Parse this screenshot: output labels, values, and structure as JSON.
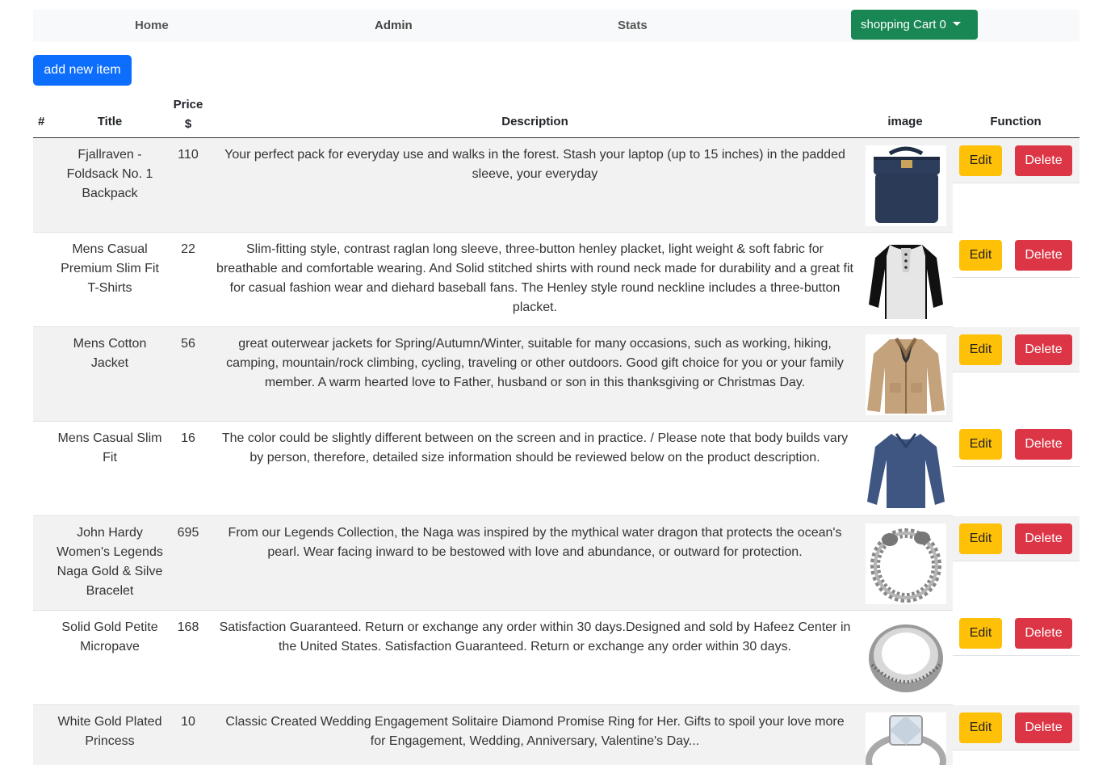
{
  "nav": {
    "home": "Home",
    "admin": "Admin",
    "stats": "Stats",
    "cart": "shopping Cart 0"
  },
  "add_button": "add new item",
  "table": {
    "headers": {
      "num": "#",
      "title": "Title",
      "price_line1": "Price",
      "price_line2": "$",
      "description": "Description",
      "image": "image",
      "function": "Function"
    },
    "edit_label": "Edit",
    "delete_label": "Delete",
    "rows": [
      {
        "title": "Fjallraven - Foldsack No. 1 Backpack",
        "price": "110",
        "description": "Your perfect pack for everyday use and walks in the forest. Stash your laptop (up to 15 inches) in the padded sleeve, your everyday",
        "image": "backpack-image"
      },
      {
        "title": "Mens Casual Premium Slim Fit T-Shirts",
        "price": "22",
        "description": "Slim-fitting style, contrast raglan long sleeve, three-button henley placket, light weight & soft fabric for breathable and comfortable wearing. And Solid stitched shirts with round neck made for durability and a great fit for casual fashion wear and diehard baseball fans. The Henley style round neckline includes a three-button placket.",
        "image": "tshirt-image"
      },
      {
        "title": "Mens Cotton Jacket",
        "price": "56",
        "description": "great outerwear jackets for Spring/Autumn/Winter, suitable for many occasions, such as working, hiking, camping, mountain/rock climbing, cycling, traveling or other outdoors. Good gift choice for you or your family member. A warm hearted love to Father, husband or son in this thanksgiving or Christmas Day.",
        "image": "jacket-image"
      },
      {
        "title": "Mens Casual Slim Fit",
        "price": "16",
        "description": "The color could be slightly different between on the screen and in practice. / Please note that body builds vary by person, therefore, detailed size information should be reviewed below on the product description.",
        "image": "longsleeve-image"
      },
      {
        "title": "John Hardy Women's Legends Naga Gold & Silve Bracelet",
        "price": "695",
        "description": "From our Legends Collection, the Naga was inspired by the mythical water dragon that protects the ocean's pearl. Wear facing inward to be bestowed with love and abundance, or outward for protection.",
        "image": "bracelet-image"
      },
      {
        "title": "Solid Gold Petite Micropave",
        "price": "168",
        "description": "Satisfaction Guaranteed. Return or exchange any order within 30 days.Designed and sold by Hafeez Center in the United States. Satisfaction Guaranteed. Return or exchange any order within 30 days.",
        "image": "ring-image"
      },
      {
        "title": "White Gold Plated Princess",
        "price": "10",
        "description": "Classic Created Wedding Engagement Solitaire Diamond Promise Ring for Her. Gifts to spoil your love more for Engagement, Wedding, Anniversary, Valentine's Day...",
        "image": "diamond-ring-image"
      }
    ]
  }
}
